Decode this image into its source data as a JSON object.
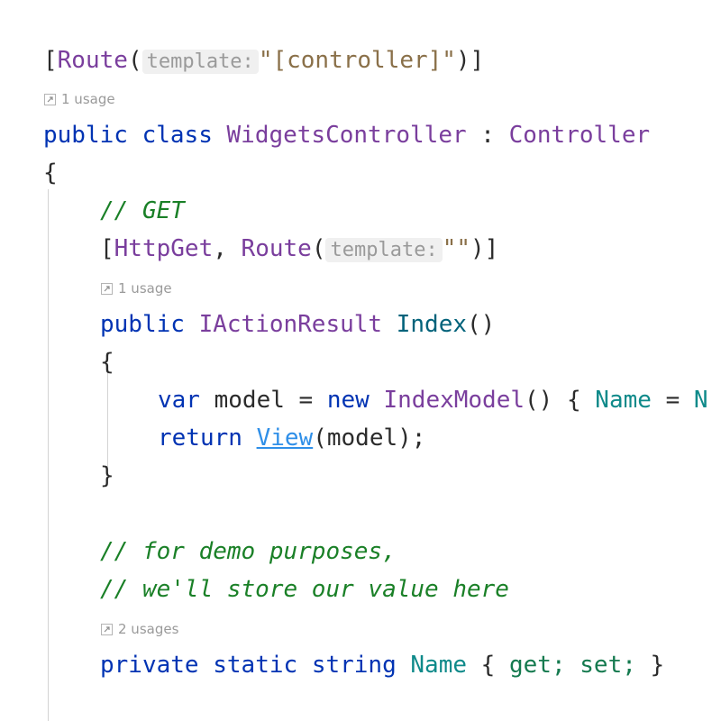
{
  "editor": {
    "background": "#ffffff",
    "language": "csharp",
    "colors": {
      "keyword": "#0033b3",
      "type": "#7a3e9d",
      "method": "#00627a",
      "teal_identifier": "#0f8a8a",
      "string": "#8a7049",
      "comment": "#1a8027",
      "accessor": "#157a4f",
      "link": "#2f8fe8",
      "punctuation": "#2b2b2b",
      "hint_text": "#9a9a9a",
      "hint_background": "#f0f0f0",
      "indent_guide": "#d3d3d3"
    }
  },
  "usage_hints": [
    {
      "id": "class-usage",
      "icon": "usage-arrow-icon",
      "label": "1 usage"
    },
    {
      "id": "index-usage",
      "icon": "usage-arrow-icon",
      "label": "1 usage"
    },
    {
      "id": "name-usage",
      "icon": "usage-arrow-icon",
      "label": "2 usages"
    }
  ],
  "lines": {
    "route_attribute": {
      "open_bracket": "[",
      "attr_name": "Route",
      "open_paren": "(",
      "param_hint": "template:",
      "string": "\"[controller]\"",
      "close": ")]"
    },
    "class_decl": {
      "modifier": "public",
      "keyword": "class",
      "name": "WidgetsController",
      "colon": " : ",
      "base": "Controller"
    },
    "class_open_brace": "{",
    "comment_get": "// GET",
    "httpget_attribute": {
      "open_bracket": "[",
      "attr1": "HttpGet",
      "comma": ", ",
      "attr2": "Route",
      "open_paren": "(",
      "param_hint": "template:",
      "string": "\"\"",
      "close": ")]"
    },
    "index_signature": {
      "modifier": "public",
      "return_type": "IActionResult",
      "name": "Index",
      "parens": "()"
    },
    "index_open_brace": "{",
    "var_model": {
      "keyword": "var",
      "variable": " model ",
      "equals": "= ",
      "new_keyword": "new",
      "type": " IndexModel",
      "parens": "() ",
      "brace": "{ ",
      "property": "Name",
      "assign": " = ",
      "value_clipped": "N"
    },
    "return_view": {
      "keyword": "return",
      "link": "View",
      "args": "(model);"
    },
    "index_close_brace": "}",
    "comment_demo_1": "// for demo purposes,",
    "comment_demo_2": "// we'll store our value here",
    "name_property": {
      "modifier1": "private",
      "modifier2": "static",
      "type": "string",
      "name": "Name",
      "open_brace": " { ",
      "get": "get;",
      "set": "set;",
      "close_brace": "}"
    }
  }
}
